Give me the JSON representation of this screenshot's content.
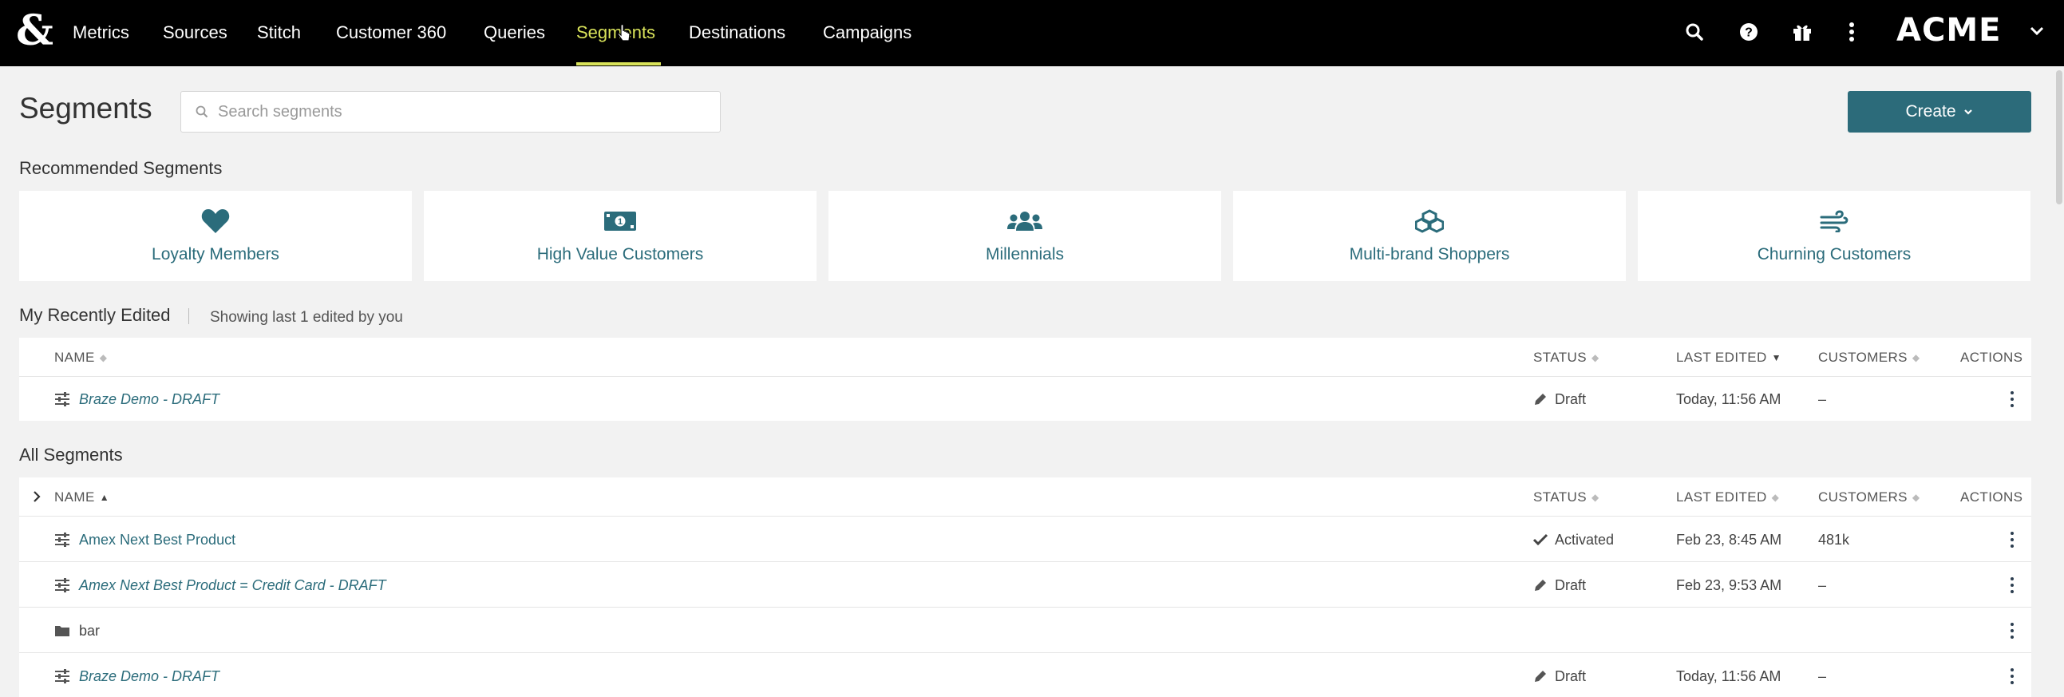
{
  "nav": {
    "items": [
      {
        "label": "Metrics"
      },
      {
        "label": "Sources"
      },
      {
        "label": "Stitch"
      },
      {
        "label": "Customer 360"
      },
      {
        "label": "Queries"
      },
      {
        "label": "Segments",
        "active": true
      },
      {
        "label": "Destinations"
      },
      {
        "label": "Campaigns"
      }
    ],
    "brand": "ACME",
    "icons": [
      "search-icon",
      "help-icon",
      "gift-icon",
      "more-vertical-icon"
    ],
    "accent_color": "#d9e35a"
  },
  "page": {
    "title": "Segments",
    "search_placeholder": "Search segments",
    "create_label": "Create"
  },
  "recommended": {
    "title": "Recommended Segments",
    "cards": [
      {
        "label": "Loyalty Members",
        "icon": "heart-icon"
      },
      {
        "label": "High Value Customers",
        "icon": "money-bill-icon"
      },
      {
        "label": "Millennials",
        "icon": "users-icon"
      },
      {
        "label": "Multi-brand Shoppers",
        "icon": "cubes-icon"
      },
      {
        "label": "Churning Customers",
        "icon": "wind-icon"
      }
    ],
    "color": "#2b6c7b"
  },
  "recent": {
    "title": "My Recently Edited",
    "subtitle": "Showing last 1 edited by you",
    "columns": [
      "NAME",
      "STATUS",
      "LAST EDITED",
      "CUSTOMERS",
      "ACTIONS"
    ],
    "rows": [
      {
        "name": "Braze Demo - DRAFT",
        "status": "Draft",
        "last_edited": "Today, 11:56 AM",
        "customers": "–"
      }
    ]
  },
  "all": {
    "title": "All Segments",
    "columns": [
      "NAME",
      "STATUS",
      "LAST EDITED",
      "CUSTOMERS",
      "ACTIONS"
    ],
    "rows": [
      {
        "name": "Amex Next Best Product",
        "status": "Activated",
        "last_edited": "Feb 23, 8:45 AM",
        "customers": "481k"
      },
      {
        "name": "Amex Next Best Product = Credit Card - DRAFT",
        "status": "Draft",
        "last_edited": "Feb 23, 9:53 AM",
        "customers": "–"
      },
      {
        "name": "bar",
        "status": "",
        "last_edited": "",
        "customers": ""
      },
      {
        "name": "Braze Demo - DRAFT",
        "status": "Draft",
        "last_edited": "Today, 11:56 AM",
        "customers": "–"
      }
    ]
  }
}
